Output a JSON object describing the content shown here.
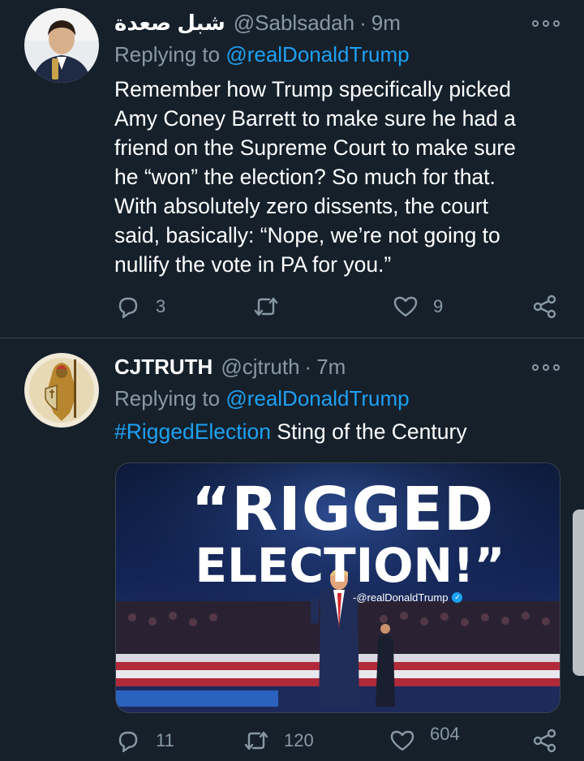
{
  "tweets": [
    {
      "name": "شبل صعدة",
      "handle": "@Sablsadah",
      "time": "9m",
      "replying_label": "Replying to",
      "replying_to": "@realDonaldTrump",
      "body_lines": [
        "Remember how Trump specifically picked",
        "Amy Coney Barrett to make sure he had a",
        "friend on the Supreme Court to make sure",
        "he “won” the election?  So much for that.",
        "With absolutely zero dissents, the court",
        "said, basically: “Nope, we’re not going to",
        "nullify the vote in PA for you.”"
      ],
      "replies": "3",
      "retweets": "",
      "likes": "9"
    },
    {
      "name": "CJTRUTH",
      "handle": "@cjtruth",
      "time": "7m",
      "replying_label": "Replying to",
      "replying_to": "@realDonaldTrump",
      "hashtag": "#RiggedElection",
      "body_text": " Sting of the Century",
      "media": {
        "line1": "“RIGGED",
        "line2": "ELECTION!”",
        "credit": "-@realDonaldTrump"
      },
      "replies": "11",
      "retweets": "120",
      "likes": "604"
    }
  ],
  "icons": {
    "reply": "reply-icon",
    "retweet": "retweet-icon",
    "like": "heart-icon",
    "share": "share-icon",
    "more": "more-options-icon"
  },
  "colors": {
    "background": "#15202b",
    "accent": "#1da1f2",
    "muted": "#8899a6",
    "divider": "#38444d"
  }
}
